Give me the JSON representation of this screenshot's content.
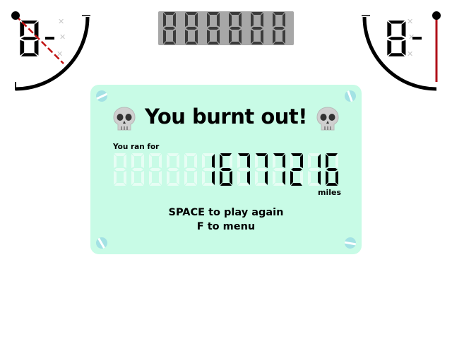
{
  "game_over": {
    "title": "You burnt out!",
    "ran_for_label": "You ran for",
    "distance_digits": "16777216",
    "distance_unit": "miles",
    "play_again_text": "SPACE to play again",
    "menu_text": "F to menu"
  },
  "top_odometer": {
    "digits": "888888"
  },
  "gauges": [
    {
      "side": "left",
      "display": "8-",
      "needle": "red-dashed"
    },
    {
      "side": "right",
      "display": "8-",
      "needle": "dark-red"
    }
  ],
  "colors": {
    "panel_background": "#c8fbe6",
    "screw": "#a3e2e4",
    "unlit_segment": "#e7fdf4",
    "odometer_background": "#a7a7a7",
    "odometer_segment": "#3b3b3b",
    "gauge_arc": "#000000",
    "needle_red": "#c01010",
    "needle_dark_red": "#b0101a"
  },
  "icons": {
    "panel_left": "skull-icon",
    "panel_right": "skull-icon",
    "gauge_tick": "light-tick-icon"
  }
}
